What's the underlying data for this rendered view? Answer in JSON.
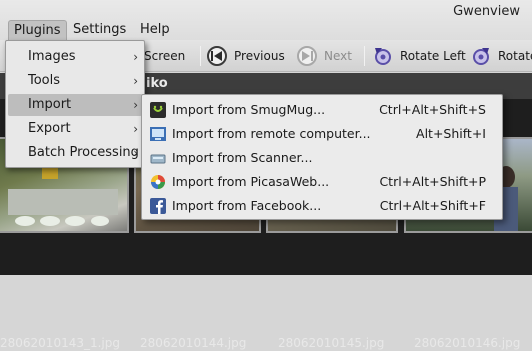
{
  "window": {
    "title": "Gwenview"
  },
  "menubar": {
    "items": [
      {
        "label": "Plugins"
      },
      {
        "label": "Settings"
      },
      {
        "label": "Help"
      }
    ]
  },
  "toolbar": {
    "fullscreen_label": "Screen",
    "previous_label": "Previous",
    "next_label": "Next",
    "rotate_left_label": "Rotate Left",
    "rotate_right_label": "Rotate"
  },
  "folder": {
    "name": "iko"
  },
  "plugins_menu": {
    "items": [
      {
        "label": "Images",
        "has_submenu": true
      },
      {
        "label": "Tools",
        "has_submenu": true
      },
      {
        "label": "Import",
        "has_submenu": true,
        "active": true
      },
      {
        "label": "Export",
        "has_submenu": true
      },
      {
        "label": "Batch Processing",
        "has_submenu": true
      }
    ]
  },
  "import_menu": {
    "items": [
      {
        "label": "Import from SmugMug...",
        "shortcut": "Ctrl+Alt+Shift+S",
        "icon": "smugmug-icon"
      },
      {
        "label": "Import from remote computer...",
        "shortcut": "Alt+Shift+I",
        "icon": "remote-computer-icon"
      },
      {
        "label": "Import from Scanner...",
        "shortcut": "",
        "icon": "scanner-icon"
      },
      {
        "label": "Import from PicasaWeb...",
        "shortcut": "Ctrl+Alt+Shift+P",
        "icon": "picasaweb-icon"
      },
      {
        "label": "Import from Facebook...",
        "shortcut": "Ctrl+Alt+Shift+F",
        "icon": "facebook-icon"
      }
    ]
  },
  "thumbnails": [
    {
      "filename": "28062010143_1.jpg"
    },
    {
      "filename": "28062010144.jpg"
    },
    {
      "filename": "28062010145.jpg"
    },
    {
      "filename": "28062010146.jpg"
    }
  ],
  "colors": {
    "menubar_bg": "#e3e3e3",
    "menu_bg": "#e8e8e8",
    "menu_highlight": "#bdbdbd",
    "thumbnail_area_bg": "#1e1e1e",
    "folder_bar_bg": "#3d3d3d"
  }
}
